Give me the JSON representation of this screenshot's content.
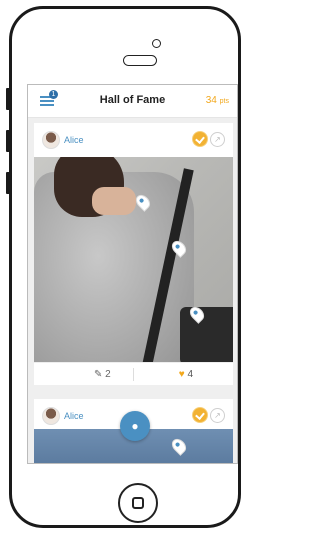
{
  "header": {
    "title": "Hall of Fame",
    "points_value": "34",
    "points_unit": "pts",
    "menu_badge_count": "1"
  },
  "feed": [
    {
      "username": "Alice",
      "comments_count": "2",
      "likes_count": "4"
    },
    {
      "username": "Alice"
    }
  ],
  "colors": {
    "accent": "#4a90c2",
    "points": "#f2a81d",
    "badge_gold": "#f2b233"
  },
  "icons": {
    "menu": "hamburger-icon",
    "camera_fab": "camera-icon",
    "like": "heart-icon",
    "comment": "comment-icon",
    "share": "share-icon",
    "badge": "gold-check-badge-icon"
  }
}
